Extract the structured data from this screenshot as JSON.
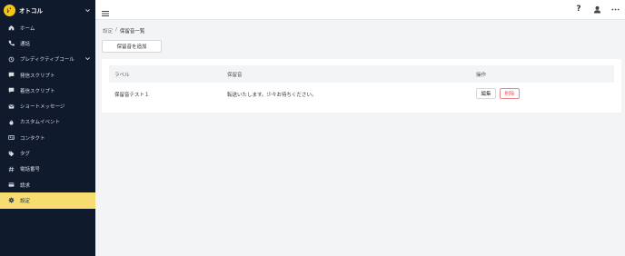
{
  "sidebar": {
    "brand": {
      "logo_text": "ﾚﾞ",
      "name": "オトコル"
    },
    "items": [
      {
        "label": "ホーム",
        "icon": "home-icon"
      },
      {
        "label": "通話",
        "icon": "phone-icon"
      },
      {
        "label": "プレディクティブコール",
        "icon": "predictive-call-icon"
      },
      {
        "label": "発信スクリプト",
        "icon": "outbound-script-icon"
      },
      {
        "label": "着信スクリプト",
        "icon": "inbound-script-icon"
      },
      {
        "label": "ショートメッセージ",
        "icon": "sms-icon"
      },
      {
        "label": "カスタムイベント",
        "icon": "flame-icon"
      },
      {
        "label": "コンタクト",
        "icon": "contact-card-icon"
      },
      {
        "label": "タグ",
        "icon": "tag-icon"
      },
      {
        "label": "電話番号",
        "icon": "hash-icon"
      },
      {
        "label": "請求",
        "icon": "credit-card-icon"
      },
      {
        "label": "設定",
        "icon": "gear-icon"
      }
    ],
    "active": "設定",
    "accent_color": "#f7dc6f",
    "background_color": "#0f1b2d"
  },
  "breadcrumb": {
    "parent": "設定",
    "separator": "/",
    "current": "保留音一覧"
  },
  "actions": {
    "add_label": "保留音を追加"
  },
  "table": {
    "headers": {
      "label": "ラベル",
      "hold_sound": "保留音",
      "operations": "操作"
    },
    "rows": [
      {
        "label": "保留音テスト１",
        "hold_sound": "転送いたします。少々お待ちください。",
        "edit": "編集",
        "delete": "削除"
      }
    ]
  },
  "header_icons": [
    "help-icon",
    "user-icon",
    "more-icon"
  ],
  "colors": {
    "danger": "#e05b5b"
  }
}
